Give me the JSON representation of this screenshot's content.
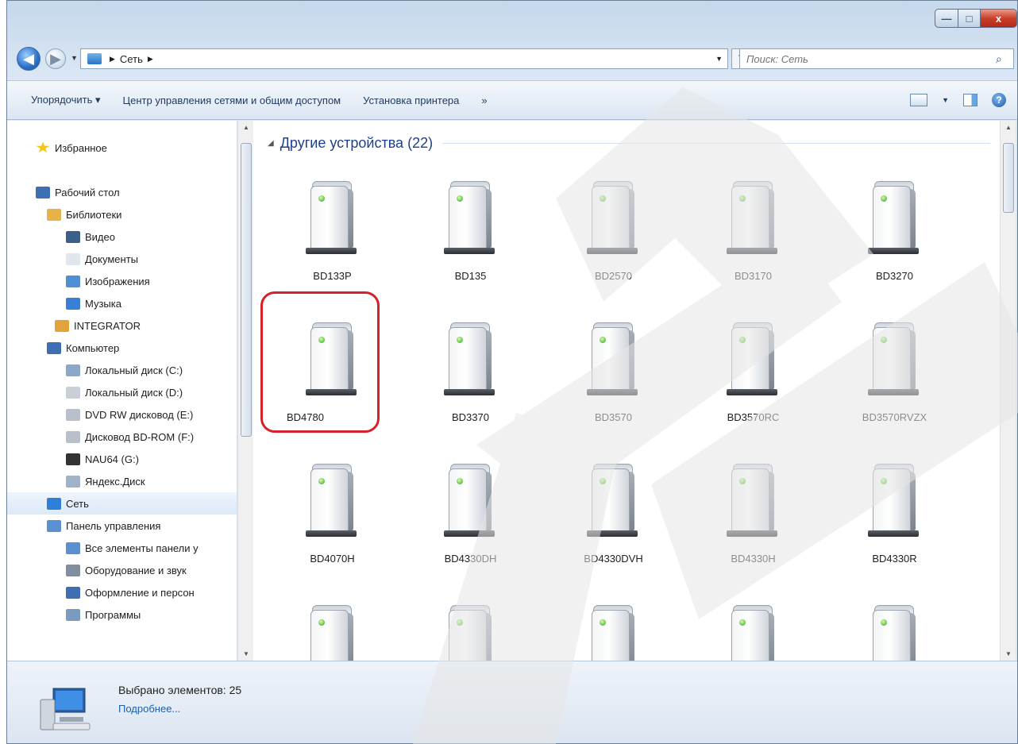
{
  "window": {
    "minimize": "—",
    "maximize": "□",
    "close": "x"
  },
  "address": {
    "back": "◀",
    "forward": "▶",
    "path": [
      "Сеть"
    ],
    "search_placeholder": "Поиск: Сеть"
  },
  "toolbar": {
    "organize": "Упорядочить ▾",
    "network_center": "Центр управления сетями и общим доступом",
    "add_printer": "Установка принтера",
    "more": "»"
  },
  "nav": {
    "items": [
      {
        "label": "Избранное",
        "icon": "star-icon"
      },
      {
        "label": "Рабочий стол",
        "icon": "desktop-icon"
      },
      {
        "label": "Библиотеки",
        "icon": "libraries-icon"
      },
      {
        "label": "Видео",
        "icon": "video-icon"
      },
      {
        "label": "Документы",
        "icon": "documents-icon"
      },
      {
        "label": "Изображения",
        "icon": "pictures-icon"
      },
      {
        "label": "Музыка",
        "icon": "music-icon"
      },
      {
        "label": "INTEGRATOR",
        "icon": "user-folder-icon"
      },
      {
        "label": "Компьютер",
        "icon": "computer-icon"
      },
      {
        "label": "Локальный диск (C:)",
        "icon": "system-drive-icon"
      },
      {
        "label": "Локальный диск (D:)",
        "icon": "drive-icon"
      },
      {
        "label": "DVD RW дисковод (E:)",
        "icon": "dvd-drive-icon"
      },
      {
        "label": "Дисковод BD-ROM (F:)",
        "icon": "bd-drive-icon"
      },
      {
        "label": "NAU64 (G:)",
        "icon": "usb-drive-icon"
      },
      {
        "label": "Яндекс.Диск",
        "icon": "cloud-icon"
      },
      {
        "label": "Сеть",
        "icon": "network-icon"
      },
      {
        "label": "Панель управления",
        "icon": "control-panel-icon"
      },
      {
        "label": "Все элементы панели у",
        "icon": "control-panel-items-icon"
      },
      {
        "label": "Оборудование и звук",
        "icon": "hardware-sound-icon"
      },
      {
        "label": "Оформление и персон",
        "icon": "personalization-icon"
      },
      {
        "label": "Программы",
        "icon": "programs-icon"
      }
    ]
  },
  "content": {
    "group_title": "Другие устройства (22)",
    "devices": [
      "BD133P",
      "BD135",
      "BD2570",
      "BD3170",
      "BD3270",
      "BD4780",
      "BD3370",
      "BD3570",
      "BD3570RC",
      "BD3570RVZX",
      "BD4070H",
      "BD4330DH",
      "BD4330DVH",
      "BD4330H",
      "BD4330R",
      "",
      "",
      "",
      "",
      ""
    ]
  },
  "details": {
    "selected": "Выбрано элементов: 25",
    "more": "Подробнее..."
  },
  "colors": {
    "highlight": "#d6202a",
    "accent": "#1e3f8f"
  }
}
